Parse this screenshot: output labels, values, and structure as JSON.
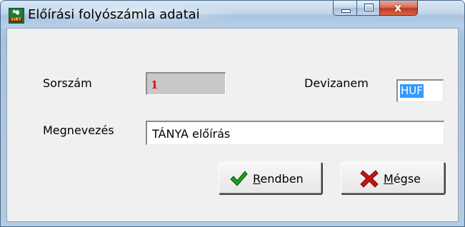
{
  "window": {
    "title": "Előírási folyószámla adatai",
    "controls": {
      "minimize_icon": "minimize-icon",
      "maximize_icon": "maximize-icon",
      "close_icon": "close-icon",
      "close_glyph": "x"
    },
    "app_icon": {
      "name": "app-icon",
      "text": "SIRT"
    }
  },
  "form": {
    "sorszam": {
      "label": "Sorszám",
      "value": "1"
    },
    "devizanem": {
      "label": "Devizanem",
      "value": "HUF"
    },
    "megnevezes": {
      "label": "Megnevezés",
      "value": "TÁNYA előírás"
    }
  },
  "buttons": {
    "ok": {
      "label_underlined": "R",
      "label_rest": "endben",
      "icon": "checkmark-icon"
    },
    "cancel": {
      "label_underlined": "M",
      "label_rest": "égse",
      "icon": "cross-icon"
    }
  },
  "colors": {
    "sorszam_value": "#e01010",
    "selection": "#3399ff",
    "ok_icon": "#1e9b1e",
    "cancel_icon": "#c81414",
    "close_button": "#c0381f"
  }
}
